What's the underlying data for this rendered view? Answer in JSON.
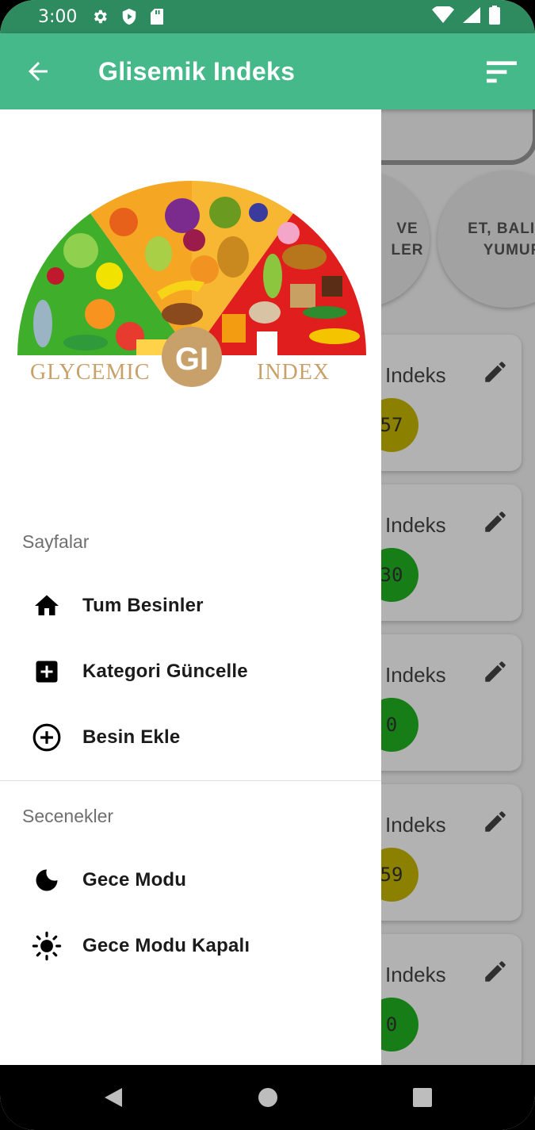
{
  "status_bar": {
    "time": "3:00",
    "icons": [
      "gear-icon",
      "shield-play-icon",
      "sd-card-icon",
      "wifi-icon",
      "signal-icon",
      "battery-icon"
    ]
  },
  "app_bar": {
    "title": "Glisemik Indeks",
    "back_icon": "arrow-left-icon",
    "sort_icon": "sort-icon",
    "color": "#45b98a"
  },
  "background": {
    "chips": [
      {
        "label_line1": "VE",
        "label_line2": "LER"
      },
      {
        "label_line1": "ET, BALIK",
        "label_line2": "YUMURTA"
      }
    ],
    "cards": [
      {
        "label": "ik Indeks",
        "value": "57",
        "color": "#c9b800"
      },
      {
        "label": "ik Indeks",
        "value": "30",
        "color": "#22b322"
      },
      {
        "label": "ik Indeks",
        "value": "0",
        "color": "#22b322"
      },
      {
        "label": "ik Indeks",
        "value": "59",
        "color": "#c9b800"
      },
      {
        "label": "ik Indeks",
        "value": "0",
        "color": "#22b322"
      }
    ]
  },
  "drawer": {
    "logo": {
      "left_text": "GLYCEMIC",
      "center_text": "GI",
      "right_text": "INDEX"
    },
    "section1": "Sayfalar",
    "pages": [
      {
        "label": "Tum Besinler",
        "icon": "home-icon"
      },
      {
        "label": "Kategori Güncelle",
        "icon": "add-box-icon"
      },
      {
        "label": "Besin Ekle",
        "icon": "add-circle-icon"
      }
    ],
    "section2": "Secenekler",
    "options": [
      {
        "label": "Gece Modu",
        "icon": "moon-icon"
      },
      {
        "label": "Gece Modu Kapalı",
        "icon": "sun-icon"
      }
    ]
  },
  "nav_bar": {
    "buttons": [
      "back-triangle-icon",
      "home-circle-icon",
      "recents-square-icon"
    ]
  }
}
